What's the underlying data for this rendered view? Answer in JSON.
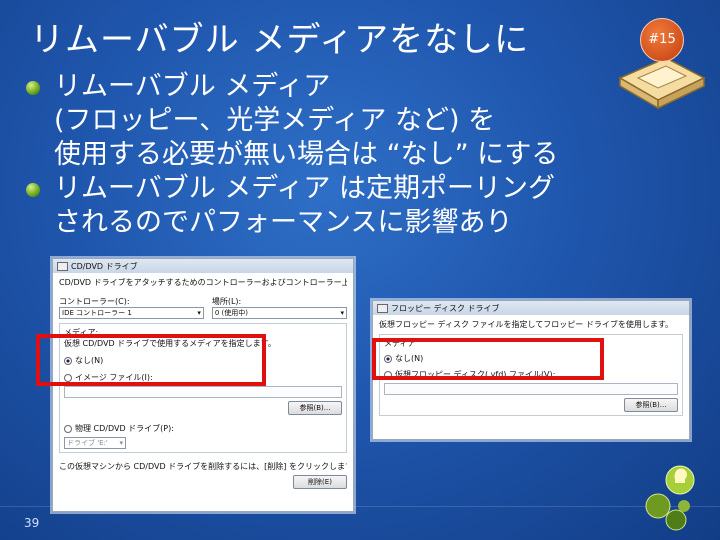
{
  "slide": {
    "title": "リムーバブル メディアをなしに",
    "badge": "#15",
    "page_number": "39",
    "bullets": [
      {
        "lines": [
          "リムーバブル メディア",
          " (フロッピー、光学メディア など) を",
          "使用する必要が無い場合は “なし” にする"
        ]
      },
      {
        "lines": [
          "リムーバブル メディア は定期ポーリング",
          "されるのでパフォーマンスに影響あり"
        ]
      }
    ]
  },
  "dialog_cd": {
    "title": "CD/DVD ドライブ",
    "description": "CD/DVD ドライブをアタッチするためのコントローラーおよびコントローラー上の場所を選択します。",
    "controller_label": "コントローラー(C):",
    "controller_value": "IDE コントローラー 1",
    "location_label": "場所(L):",
    "location_value": "0 (使用中)",
    "media_label": "メディア:",
    "media_description": "仮想 CD/DVD ドライブで使用するメディアを指定します。",
    "option_none": "なし(N)",
    "option_image": "イメージ ファイル(I):",
    "browse_label": "参照(B)...",
    "option_physical": "物理 CD/DVD ドライブ(P):",
    "physical_drive_value": "ドライブ 'E:'",
    "bottom_text": "この仮想マシンから CD/DVD ドライブを削除するには、[削除] をクリックします。",
    "remove_label": "削除(E)"
  },
  "dialog_floppy": {
    "title": "フロッピー ディスク ドライブ",
    "description": "仮想フロッピー ディスク ファイルを指定してフロッピー ドライブを使用します。",
    "media_label": "メディア",
    "option_none": "なし(N)",
    "option_vfd": "仮想フロッピー ディスク(.vfd) ファイル(V):",
    "browse_label": "参照(B)..."
  },
  "colors": {
    "background": "#1f56ad",
    "highlight_box": "#e01010",
    "bullet": "#6aa518",
    "badge": "#c33f10"
  }
}
